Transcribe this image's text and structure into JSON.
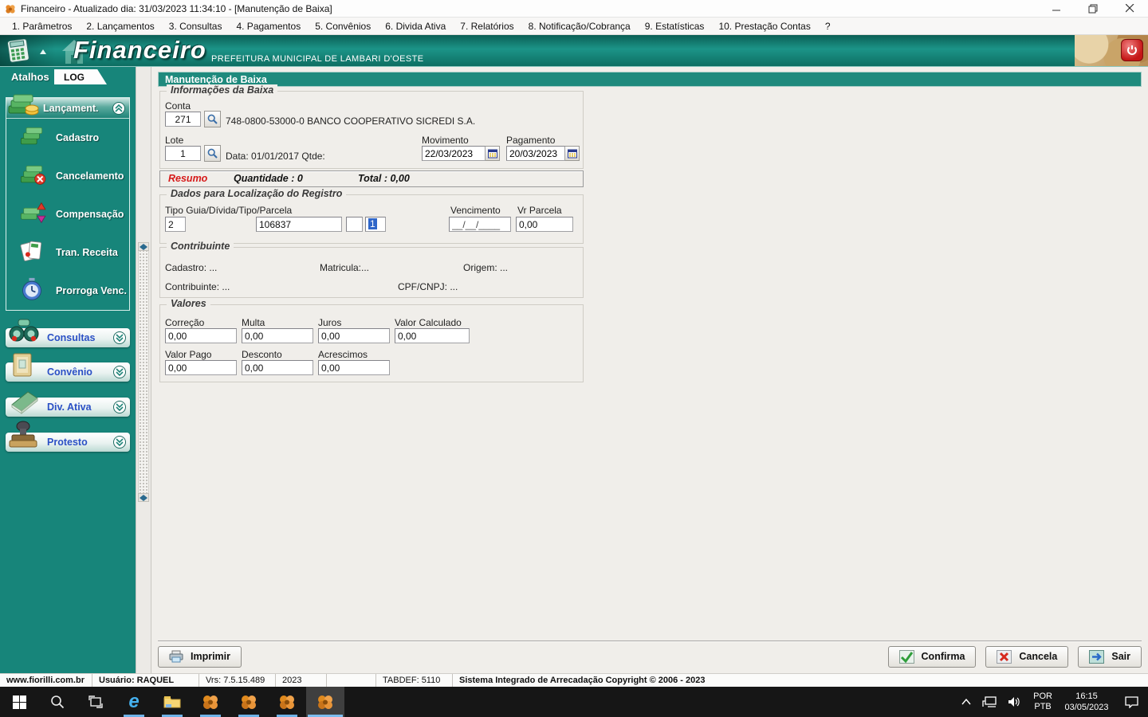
{
  "window": {
    "title": "Financeiro - Atualizado dia: 31/03/2023 11:34:10 - [Manutenção de Baixa]"
  },
  "menu": {
    "items": [
      "1. Parâmetros",
      "2. Lançamentos",
      "3. Consultas",
      "4. Pagamentos",
      "5. Convênios",
      "6. Divida Ativa",
      "7. Relatórios",
      "8. Notificação/Cobrança",
      "9. Estatísticas",
      "10. Prestação Contas",
      "?"
    ]
  },
  "header": {
    "app_name": "Financeiro",
    "organization": "PREFEITURA MUNICIPAL DE LAMBARI D'OESTE"
  },
  "sidebar": {
    "atalhos_label": "Atalhos",
    "log_label": "LOG",
    "expanded_group": {
      "label": "Lançament.",
      "items": [
        "Cadastro",
        "Cancelamento",
        "Compensação",
        "Tran. Receita",
        "Prorroga Venc."
      ]
    },
    "collapsed_groups": [
      "Consultas",
      "Convênio",
      "Div. Ativa",
      "Protesto"
    ]
  },
  "form": {
    "title": "Manutenção de Baixa",
    "info": {
      "title": "Informações da Baixa",
      "conta_label": "Conta",
      "conta_value": "271",
      "conta_desc": "748-0800-53000-0 BANCO COOPERATIVO SICREDI S.A.",
      "lote_label": "Lote",
      "lote_value": "1",
      "lote_data": "Data: 01/01/2017 Qtde:",
      "movimento_label": "Movimento",
      "movimento_value": "22/03/2023",
      "pagamento_label": "Pagamento",
      "pagamento_value": "20/03/2023"
    },
    "resumo": {
      "label": "Resumo",
      "quantidade": "Quantidade : 0",
      "total": "Total : 0,00"
    },
    "localizacao": {
      "title": "Dados para Localização do Registro",
      "tipo_label": "Tipo Guia/Dívida/Tipo/Parcela",
      "tipo_value": "2",
      "guia_value": "106837",
      "divida_value": "",
      "parcela_value": "1",
      "vencimento_label": "Vencimento",
      "vencimento_value": "__/__/____",
      "vr_parcela_label": "Vr Parcela",
      "vr_parcela_value": "0,00"
    },
    "contribuinte": {
      "title": "Contribuinte",
      "cadastro": "Cadastro: ...",
      "matricula": "Matricula:...",
      "origem": "Origem: ...",
      "contribuinte": "Contribuinte: ...",
      "cpf_cnpj": "CPF/CNPJ: ..."
    },
    "valores": {
      "title": "Valores",
      "fields": [
        {
          "label": "Correção",
          "value": "0,00"
        },
        {
          "label": "Multa",
          "value": "0,00"
        },
        {
          "label": "Juros",
          "value": "0,00"
        },
        {
          "label": "Valor Calculado",
          "value": "0,00"
        },
        {
          "label": "Valor Pago",
          "value": "0,00"
        },
        {
          "label": "Desconto",
          "value": "0,00"
        },
        {
          "label": "Acrescimos",
          "value": "0,00"
        }
      ]
    },
    "actions": {
      "imprimir": "Imprimir",
      "confirma": "Confirma",
      "cancela": "Cancela",
      "sair": "Sair"
    }
  },
  "statusbar": {
    "segments": [
      "www.fiorilli.com.br",
      "Usuário: RAQUEL",
      "Vrs: 7.5.15.489",
      "2023",
      "TABDEF: 5110",
      "Sistema Integrado de Arrecadação Copyright © 2006 - 2023"
    ]
  },
  "taskbar": {
    "tray": {
      "lang_top": "POR",
      "lang_bottom": "PTB",
      "time": "16:15",
      "date": "03/05/2023"
    }
  }
}
